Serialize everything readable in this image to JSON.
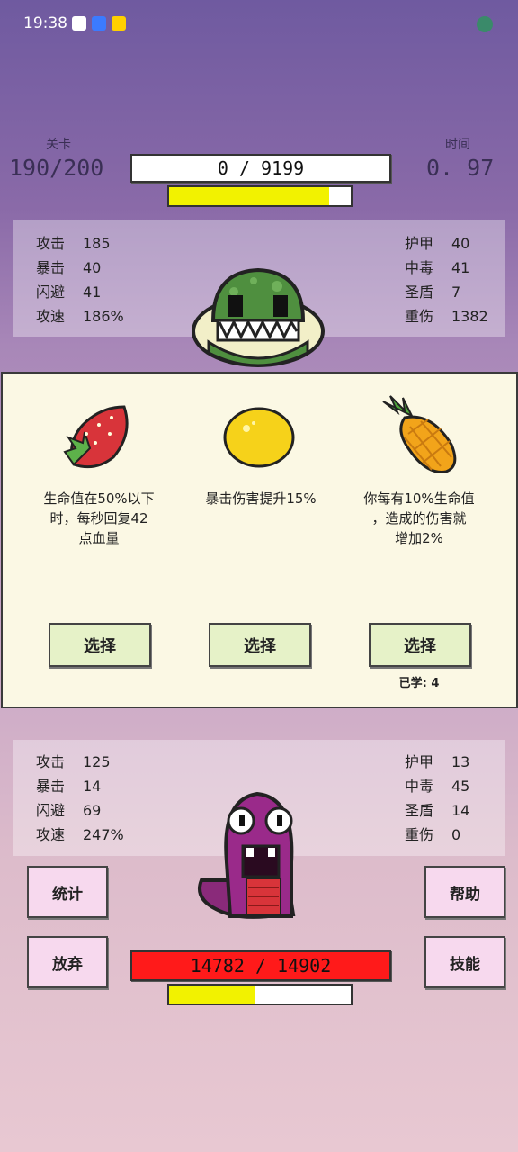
{
  "status": {
    "time": "19:38"
  },
  "header": {
    "level_label": "关卡",
    "level_value": "190/200",
    "time_label": "时间",
    "time_value": "0. 97",
    "enemy_hp_text": "0 / 9199",
    "enemy_charge": 0.88
  },
  "enemy_stats": {
    "left": [
      {
        "k": "攻击",
        "v": "185"
      },
      {
        "k": "暴击",
        "v": "40"
      },
      {
        "k": "闪避",
        "v": "41"
      },
      {
        "k": "攻速",
        "v": "186%"
      }
    ],
    "right": [
      {
        "k": "护甲",
        "v": "40"
      },
      {
        "k": "中毒",
        "v": "41"
      },
      {
        "k": "圣盾",
        "v": "7"
      },
      {
        "k": "重伤",
        "v": "1382"
      }
    ]
  },
  "options": [
    {
      "icon": "strawberry-icon",
      "line1": "生命值在50%以下",
      "line2": "时，每秒回复42",
      "line3": "点血量",
      "button": "选择"
    },
    {
      "icon": "lemon-icon",
      "line1": "暴击伤害提升15%",
      "line2": "",
      "line3": "",
      "button": "选择"
    },
    {
      "icon": "pineapple-icon",
      "line1": "你每有10%生命值",
      "line2": "，造成的伤害就",
      "line3": "增加2%",
      "button": "选择"
    }
  ],
  "learned_text": "已学: 4",
  "player_stats": {
    "left": [
      {
        "k": "攻击",
        "v": "125"
      },
      {
        "k": "暴击",
        "v": "14"
      },
      {
        "k": "闪避",
        "v": "69"
      },
      {
        "k": "攻速",
        "v": "247%"
      }
    ],
    "right": [
      {
        "k": "护甲",
        "v": "13"
      },
      {
        "k": "中毒",
        "v": "45"
      },
      {
        "k": "圣盾",
        "v": "14"
      },
      {
        "k": "重伤",
        "v": "0"
      }
    ]
  },
  "buttons": {
    "stats": "统计",
    "help": "帮助",
    "give_up": "放弃",
    "skills": "技能"
  },
  "player_hp_text": "14782  /  14902",
  "player_charge": 0.47,
  "colors": {
    "hp_red": "#ff1a1a",
    "charge_yellow": "#f2f200"
  }
}
